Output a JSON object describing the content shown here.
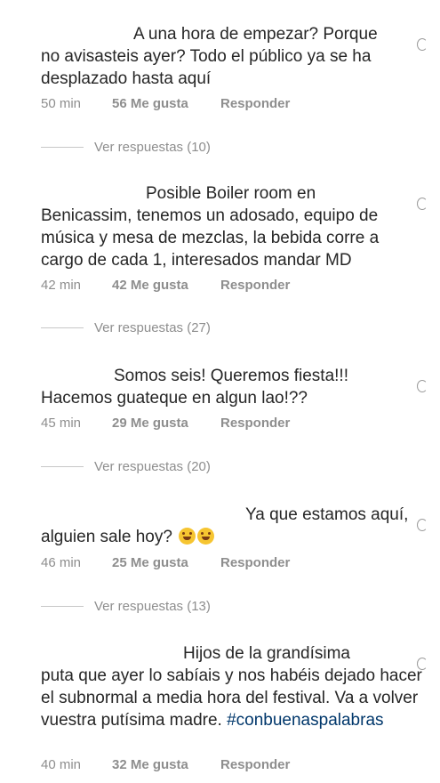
{
  "comments": [
    {
      "line1": "A una hora de empezar? Porque",
      "rest": "no avisasteis ayer? Todo el público ya se ha desplazado hasta aquí",
      "time": "50 min",
      "likes": "56 Me gusta",
      "reply": "Responder",
      "replies": "Ver respuestas (10)"
    },
    {
      "line1": "Posible Boiler room en",
      "rest": "Benicassim, tenemos un adosado, equipo de música y mesa de mezclas, la bebida corre a cargo de cada 1, interesados mandar MD",
      "time": "42 min",
      "likes": "42 Me gusta",
      "reply": "Responder",
      "replies": "Ver respuestas (27)"
    },
    {
      "line1": "Somos seis! Queremos fiesta!!!",
      "rest": "Hacemos guateque en algun lao!??",
      "time": "45 min",
      "likes": "29 Me gusta",
      "reply": "Responder",
      "replies": "Ver respuestas (20)"
    },
    {
      "line1": "Ya que estamos aquí,",
      "rest": "alguien sale hoy?",
      "emoji": "grinning-sweat-emoji",
      "time": "46 min",
      "likes": "25 Me gusta",
      "reply": "Responder",
      "replies": "Ver respuestas (13)"
    },
    {
      "line1": "Hijos de la grandísima",
      "rest": "puta que ayer lo sabíais y nos habéis dejado hacer el subnormal a media hora del festival. Va a volver vuestra putísima madre.",
      "hashtag": "#conbuenaspalabras",
      "time": "40 min",
      "likes": "32 Me gusta",
      "reply": "Responder"
    }
  ],
  "colors": {
    "text": "#262626",
    "meta": "#8e8e8e",
    "hashtag": "#00376b"
  },
  "icons": {
    "like": "heart-outline-icon"
  }
}
